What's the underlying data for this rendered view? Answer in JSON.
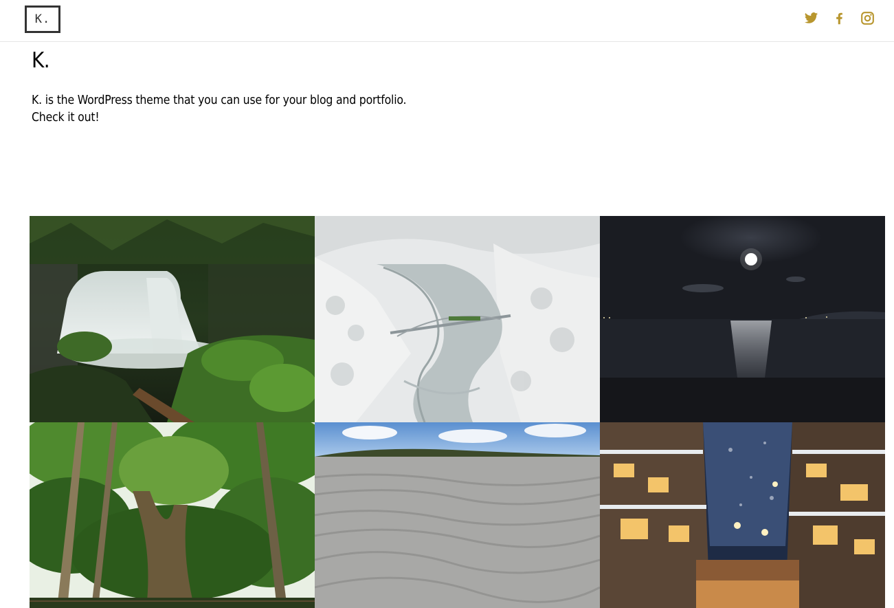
{
  "header": {
    "logo_text": "K.",
    "social": [
      {
        "name": "twitter",
        "icon": "twitter-icon"
      },
      {
        "name": "facebook",
        "icon": "facebook-icon"
      },
      {
        "name": "instagram",
        "icon": "instagram-icon"
      }
    ],
    "accent_color": "#b8962e"
  },
  "intro": {
    "title": "K.",
    "description_line1": "K. is the WordPress theme that you can use for your blog and portfolio.",
    "description_line2": "Check it out!"
  },
  "gallery": {
    "items": [
      {
        "subject": "waterfall in forest"
      },
      {
        "subject": "snowy valley with bridge and train"
      },
      {
        "subject": "full moon over sea at night"
      },
      {
        "subject": "giant tree in green forest"
      },
      {
        "subject": "rippled sand dunes under blue sky"
      },
      {
        "subject": "snowy hot spring town at night"
      }
    ]
  }
}
